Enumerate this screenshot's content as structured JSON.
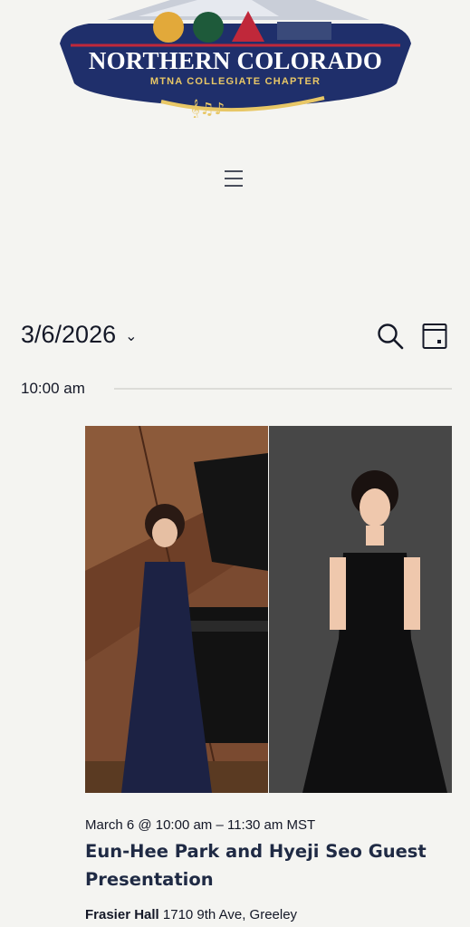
{
  "header": {
    "logo_title": "NORTHERN COLORADO",
    "logo_subtitle": "MTNA COLLEGIATE CHAPTER",
    "menu_icon": "hamburger-menu-icon"
  },
  "toolbar": {
    "date_value": "3/6/2026",
    "date_chevron": "⌄",
    "search_icon": "search-icon",
    "view_icon": "calendar-view-icon"
  },
  "schedule": {
    "time_label": "10:00 am"
  },
  "event": {
    "datetime": "March 6 @ 10:00 am – 11:30 am MST",
    "title": "Eun-Hee Park and Hyeji Seo Guest Presentation",
    "venue_name": "Frasier Hall",
    "venue_address": " 1710 9th Ave, Greeley"
  },
  "colors": {
    "background": "#f4f4f1",
    "text": "#141827",
    "title": "#1f2a44",
    "logo_navy": "#1f2f6b",
    "logo_gold": "#e8c766"
  }
}
